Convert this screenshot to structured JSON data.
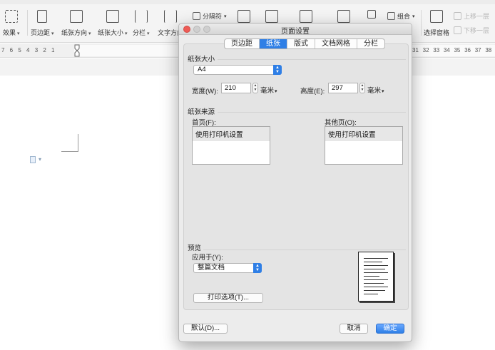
{
  "ribbon": {
    "buttons": [
      {
        "label": "效果"
      },
      {
        "label": "页边距"
      },
      {
        "label": "纸张方向"
      },
      {
        "label": "纸张大小"
      },
      {
        "label": "分栏"
      },
      {
        "label": "文字方向"
      }
    ],
    "separator_label": "分隔符",
    "combine_label": "组合",
    "selection_pane_label": "选择窗格",
    "move_up_label": "上移一层",
    "move_down_label": "下移一层"
  },
  "ruler": {
    "left_numbers": "7 6 5 4 3 2 1",
    "right_numbers": "31 32 33 34 35 36 37 38"
  },
  "dialog": {
    "title": "页面设置",
    "tabs": [
      "页边距",
      "纸张",
      "版式",
      "文档网格",
      "分栏"
    ],
    "active_tab": "纸张",
    "paper_size": {
      "section_label": "纸张大小",
      "selected": "A4",
      "width_label": "宽度(W):",
      "width_value": "210",
      "width_unit": "毫米",
      "height_label": "高度(E):",
      "height_value": "297",
      "height_unit": "毫米"
    },
    "paper_source": {
      "section_label": "纸张来源",
      "first_page_label": "首页(F):",
      "first_page_item": "使用打印机设置",
      "other_pages_label": "其他页(O):",
      "other_pages_item": "使用打印机设置"
    },
    "preview": {
      "section_label": "预览",
      "apply_to_label": "应用于(Y):",
      "apply_to_value": "整篇文档",
      "print_options_label": "打印选项(T)..."
    },
    "buttons": {
      "default_label": "默认(D)...",
      "cancel_label": "取消",
      "ok_label": "确定"
    },
    "colors": {
      "accent": "#2f7fe6",
      "close_button": "#ee5b55"
    }
  }
}
